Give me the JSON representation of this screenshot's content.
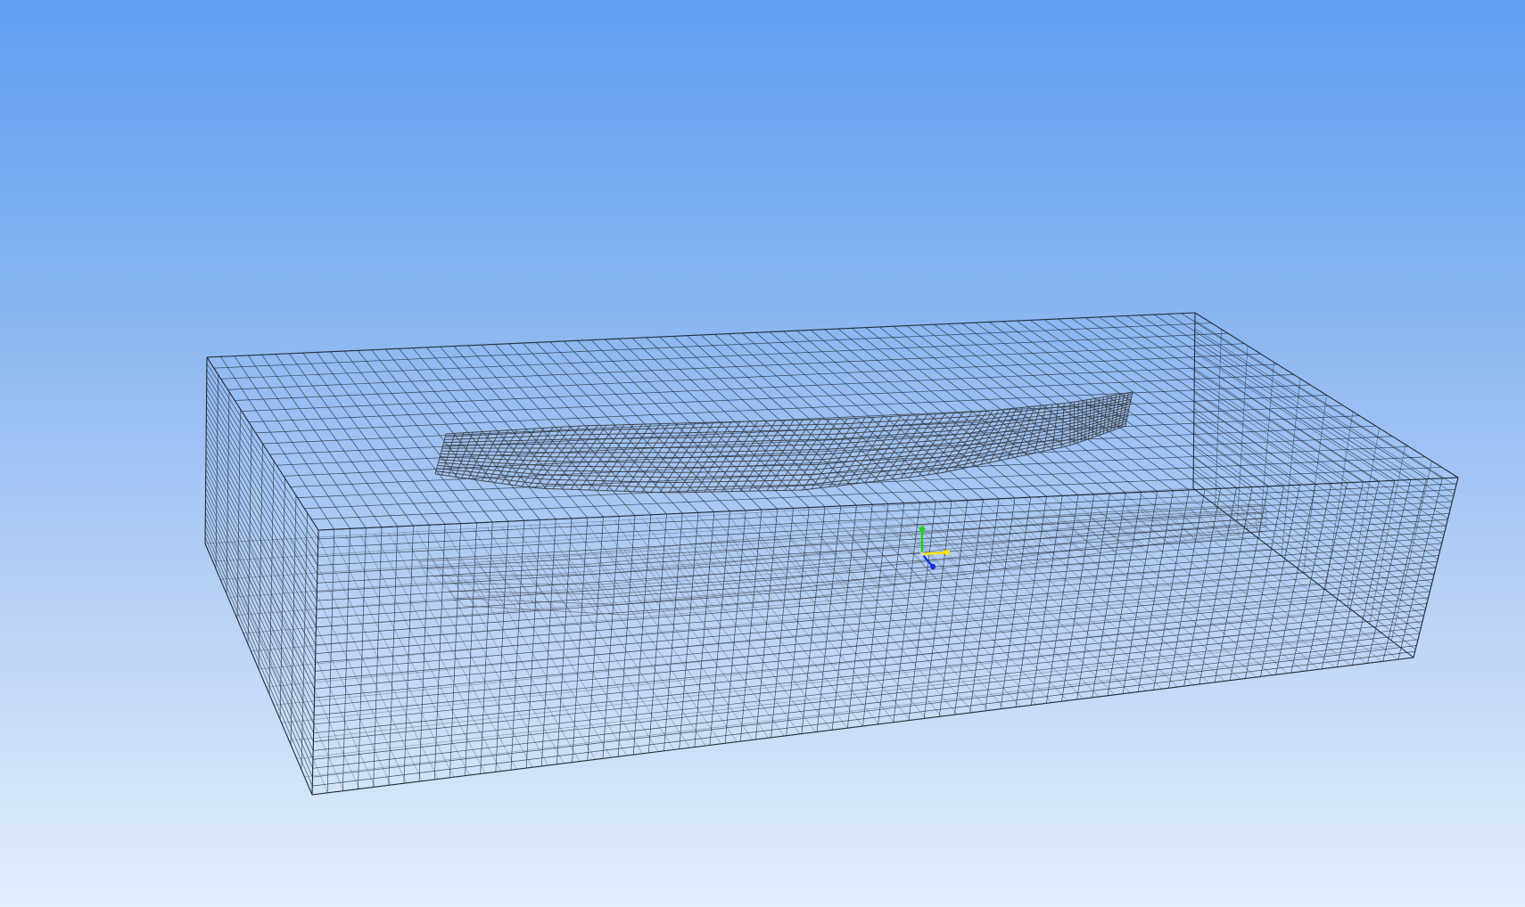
{
  "viewport": {
    "background_top": "#5f9ff0",
    "background_bottom": "#e3effd",
    "mesh_line_color": "#1f2933",
    "hull_line_color": "#3a3a3a"
  },
  "triad": {
    "x_axis_color": "#ffe600",
    "y_axis_color": "#19d219",
    "z_axis_color": "#1530e0"
  },
  "icons": {
    "triad": "xyz-triad-icon"
  }
}
